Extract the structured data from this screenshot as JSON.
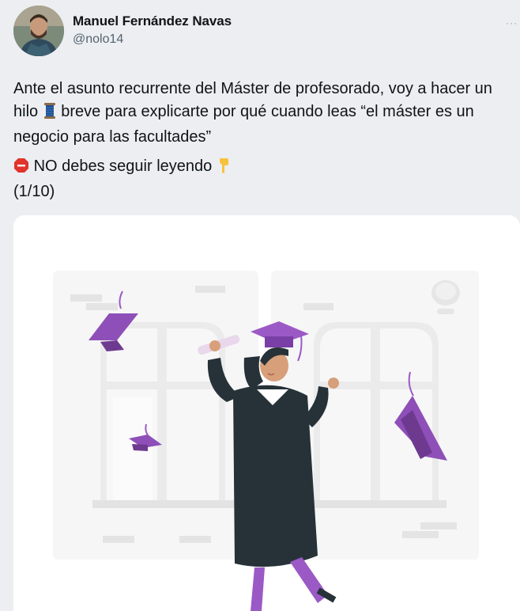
{
  "author": {
    "name": "Manuel Fernández Navas",
    "handle": "@nolo14"
  },
  "more_menu": "···",
  "tweet": {
    "line1_before": "Ante el asunto recurrente del Máster de profesorado, voy a hacer un hilo",
    "thread_emoji": "spool-of-thread-icon",
    "line1_after": "breve para explicarte por qué cuando leas “el máster es un negocio para las facultades”",
    "line2_after_icon": "NO debes seguir leyendo",
    "stop_emoji": "stop-sign-icon",
    "pointing_emoji": "pointing-down-icon",
    "line3": "(1/10)"
  },
  "media": {
    "illustration": "graduation-illustration",
    "colors": {
      "accent": "#9b59c6",
      "gown": "#263238",
      "background": "#ffffff"
    }
  }
}
